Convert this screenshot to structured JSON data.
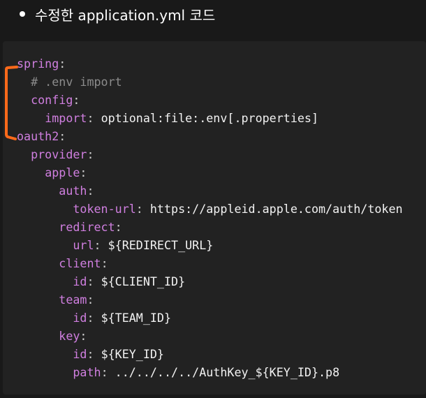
{
  "heading": {
    "text": "수정한 application.yml 코드"
  },
  "annotation": {
    "color": "#ff6a1a"
  },
  "colors": {
    "key": "#d07fe0",
    "value": "#f2f2f2",
    "comment": "#8c8c8c",
    "code_background": "#222222",
    "page_background": "#191919"
  },
  "code": {
    "language": "yaml",
    "lines": [
      {
        "indent": "",
        "key": "spring",
        "sep": ":",
        "value": "",
        "comment": ""
      },
      {
        "indent": "  ",
        "key": "",
        "sep": "",
        "value": "",
        "comment": "# .env import"
      },
      {
        "indent": "  ",
        "key": "config",
        "sep": ":",
        "value": "",
        "comment": ""
      },
      {
        "indent": "    ",
        "key": "import",
        "sep": ": ",
        "value": "optional:file:.env[.properties]",
        "comment": ""
      },
      {
        "indent": "",
        "key": "oauth2",
        "sep": ":",
        "value": "",
        "comment": ""
      },
      {
        "indent": "  ",
        "key": "provider",
        "sep": ":",
        "value": "",
        "comment": ""
      },
      {
        "indent": "    ",
        "key": "apple",
        "sep": ":",
        "value": "",
        "comment": ""
      },
      {
        "indent": "      ",
        "key": "auth",
        "sep": ":",
        "value": "",
        "comment": ""
      },
      {
        "indent": "        ",
        "key": "token-url",
        "sep": ": ",
        "value": "https://appleid.apple.com/auth/token",
        "comment": ""
      },
      {
        "indent": "      ",
        "key": "redirect",
        "sep": ":",
        "value": "",
        "comment": ""
      },
      {
        "indent": "        ",
        "key": "url",
        "sep": ": ",
        "value": "${REDIRECT_URL}",
        "comment": ""
      },
      {
        "indent": "      ",
        "key": "client",
        "sep": ":",
        "value": "",
        "comment": ""
      },
      {
        "indent": "        ",
        "key": "id",
        "sep": ": ",
        "value": "${CLIENT_ID}",
        "comment": ""
      },
      {
        "indent": "      ",
        "key": "team",
        "sep": ":",
        "value": "",
        "comment": ""
      },
      {
        "indent": "        ",
        "key": "id",
        "sep": ": ",
        "value": "${TEAM_ID}",
        "comment": ""
      },
      {
        "indent": "      ",
        "key": "key",
        "sep": ":",
        "value": "",
        "comment": ""
      },
      {
        "indent": "        ",
        "key": "id",
        "sep": ": ",
        "value": "${KEY_ID}",
        "comment": ""
      },
      {
        "indent": "        ",
        "key": "path",
        "sep": ": ",
        "value": "../../../../AuthKey_${KEY_ID}.p8",
        "comment": ""
      }
    ]
  }
}
